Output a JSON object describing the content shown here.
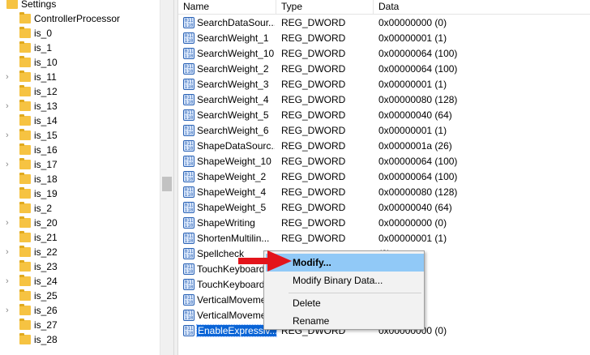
{
  "tree": {
    "top_item": "Settings",
    "items": [
      {
        "label": "ControllerProcessor",
        "chevron": false
      },
      {
        "label": "is_0",
        "chevron": false
      },
      {
        "label": "is_1",
        "chevron": false
      },
      {
        "label": "is_10",
        "chevron": false
      },
      {
        "label": "is_11",
        "chevron": true
      },
      {
        "label": "is_12",
        "chevron": false
      },
      {
        "label": "is_13",
        "chevron": true
      },
      {
        "label": "is_14",
        "chevron": false
      },
      {
        "label": "is_15",
        "chevron": true
      },
      {
        "label": "is_16",
        "chevron": false
      },
      {
        "label": "is_17",
        "chevron": true
      },
      {
        "label": "is_18",
        "chevron": false
      },
      {
        "label": "is_19",
        "chevron": false
      },
      {
        "label": "is_2",
        "chevron": false
      },
      {
        "label": "is_20",
        "chevron": true
      },
      {
        "label": "is_21",
        "chevron": false
      },
      {
        "label": "is_22",
        "chevron": true
      },
      {
        "label": "is_23",
        "chevron": false
      },
      {
        "label": "is_24",
        "chevron": true
      },
      {
        "label": "is_25",
        "chevron": false
      },
      {
        "label": "is_26",
        "chevron": true
      },
      {
        "label": "is_27",
        "chevron": false
      },
      {
        "label": "is_28",
        "chevron": false
      }
    ]
  },
  "list": {
    "columns": {
      "name": "Name",
      "type": "Type",
      "data": "Data"
    },
    "rows": [
      {
        "name": "SearchDataSour...",
        "type": "REG_DWORD",
        "data": "0x00000000 (0)"
      },
      {
        "name": "SearchWeight_1",
        "type": "REG_DWORD",
        "data": "0x00000001 (1)"
      },
      {
        "name": "SearchWeight_10",
        "type": "REG_DWORD",
        "data": "0x00000064 (100)"
      },
      {
        "name": "SearchWeight_2",
        "type": "REG_DWORD",
        "data": "0x00000064 (100)"
      },
      {
        "name": "SearchWeight_3",
        "type": "REG_DWORD",
        "data": "0x00000001 (1)"
      },
      {
        "name": "SearchWeight_4",
        "type": "REG_DWORD",
        "data": "0x00000080 (128)"
      },
      {
        "name": "SearchWeight_5",
        "type": "REG_DWORD",
        "data": "0x00000040 (64)"
      },
      {
        "name": "SearchWeight_6",
        "type": "REG_DWORD",
        "data": "0x00000001 (1)"
      },
      {
        "name": "ShapeDataSourc...",
        "type": "REG_DWORD",
        "data": "0x0000001a (26)"
      },
      {
        "name": "ShapeWeight_10",
        "type": "REG_DWORD",
        "data": "0x00000064 (100)"
      },
      {
        "name": "ShapeWeight_2",
        "type": "REG_DWORD",
        "data": "0x00000064 (100)"
      },
      {
        "name": "ShapeWeight_4",
        "type": "REG_DWORD",
        "data": "0x00000080 (128)"
      },
      {
        "name": "ShapeWeight_5",
        "type": "REG_DWORD",
        "data": "0x00000040 (64)"
      },
      {
        "name": "ShapeWriting",
        "type": "REG_DWORD",
        "data": "0x00000000 (0)"
      },
      {
        "name": "ShortenMultilin...",
        "type": "REG_DWORD",
        "data": "0x00000001 (1)"
      },
      {
        "name": "Spellcheck",
        "type": "",
        "data": "(0)"
      },
      {
        "name": "TouchKeyboard",
        "type": "",
        "data": "(1)"
      },
      {
        "name": "TouchKeyboard",
        "type": "",
        "data": "(1)"
      },
      {
        "name": "VerticalMoveme",
        "type": "",
        "data": "(135)"
      },
      {
        "name": "VerticalMoveme",
        "type": "",
        "data": "(135)"
      },
      {
        "name": "EnableExpressiv...",
        "type": "REG_DWORD",
        "data": "0x00000000 (0)",
        "selected": true
      }
    ]
  },
  "context_menu": {
    "items": [
      "Modify...",
      "Modify Binary Data...",
      "Delete",
      "Rename"
    ]
  },
  "colors": {
    "selection": "#0a64d6",
    "menu_highlight": "#91c9f7",
    "arrow": "#e3141b",
    "folder": "#f6c342"
  },
  "icons": {
    "tree_folder": "folder-icon",
    "tree_chevron": "chevron-right-icon",
    "value_icon": "reg-dword-icon"
  }
}
